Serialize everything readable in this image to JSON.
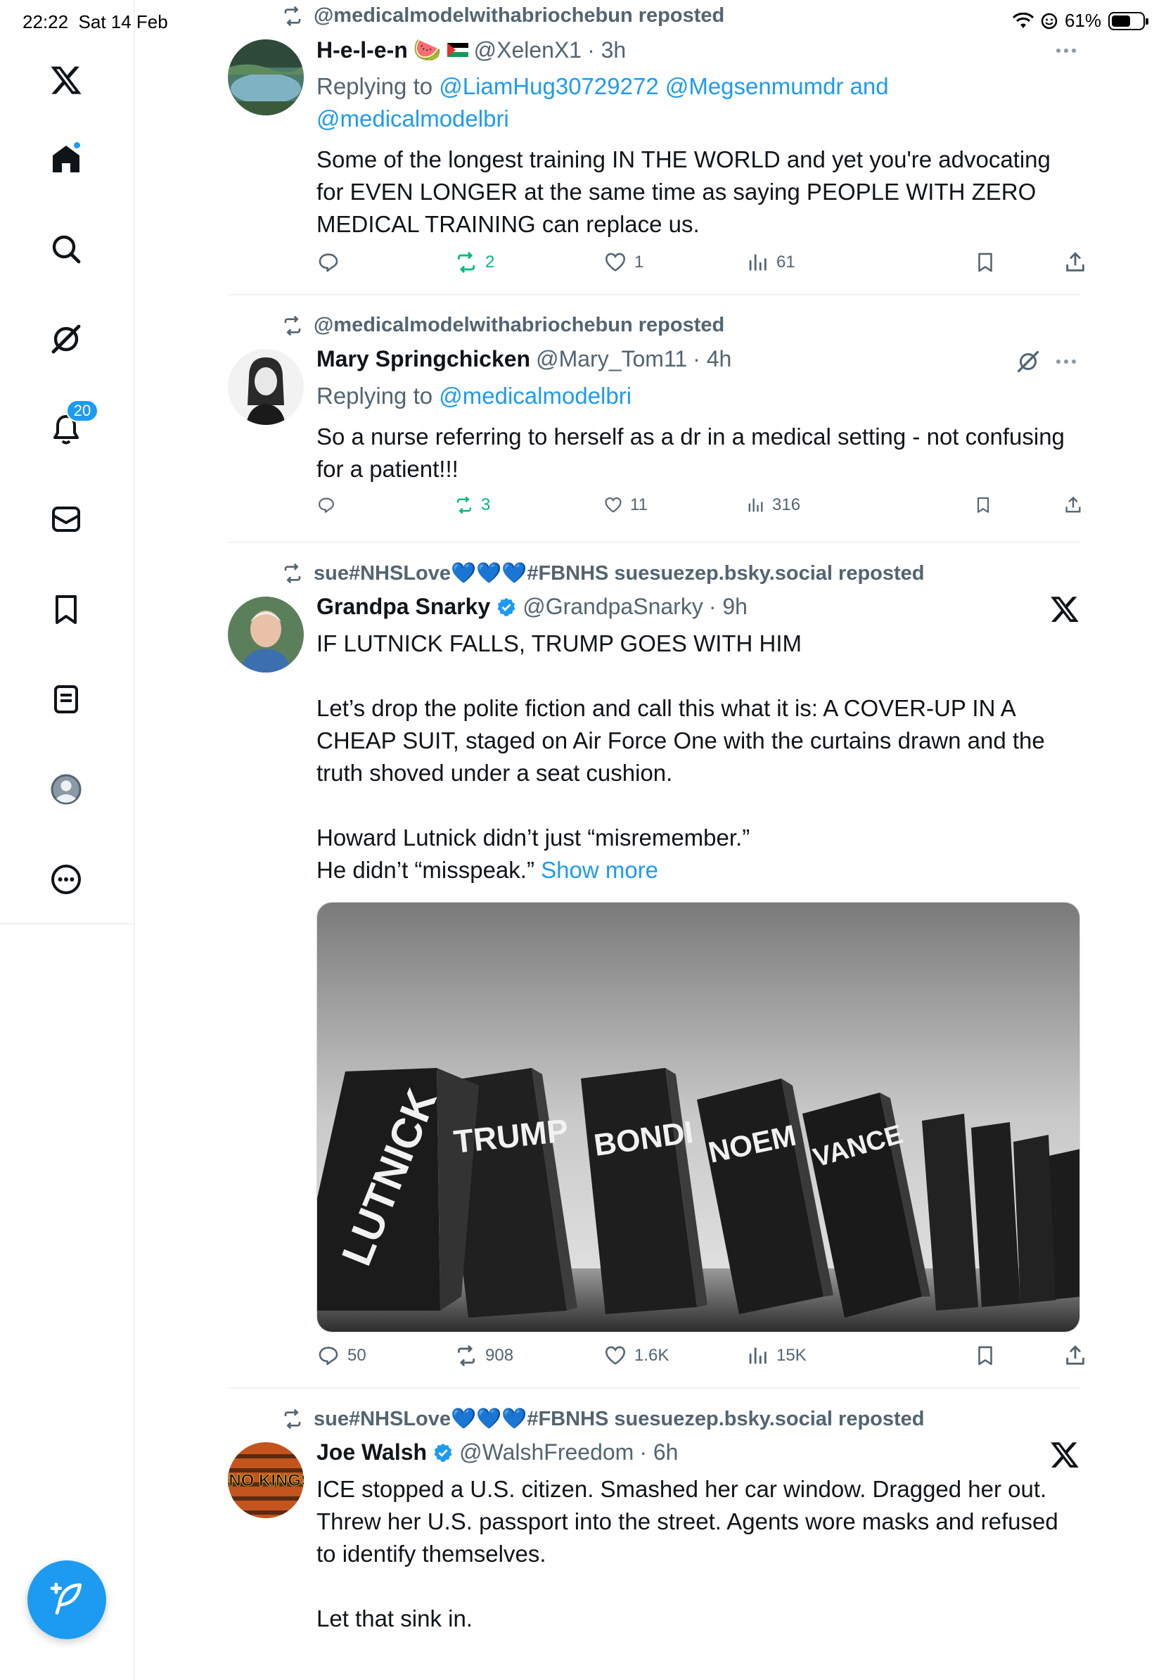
{
  "status": {
    "time": "22:22",
    "date": "Sat 14 Feb",
    "battery": "61%",
    "battery_level": 0.61
  },
  "sidebar": {
    "items": [
      {
        "icon": "x-logo-icon"
      },
      {
        "icon": "home-icon"
      },
      {
        "icon": "search-icon"
      },
      {
        "icon": "grok-icon"
      },
      {
        "icon": "bell-icon",
        "badge": "20"
      },
      {
        "icon": "mail-icon"
      },
      {
        "icon": "bookmark-icon"
      },
      {
        "icon": "list-icon"
      },
      {
        "icon": "profile-icon"
      },
      {
        "icon": "more-icon"
      }
    ],
    "compose_icon": "compose-icon"
  },
  "tweets": [
    {
      "repost_by": "@medicalmodelwithabriochebun reposted",
      "name": "H-e-l-e-n",
      "name_emoji": "🍉",
      "handle": "@XelenX1",
      "time": "· 3h",
      "reply_prefix": "Replying to",
      "reply_links": "@LiamHug30729272 @Megsenmumdr and",
      "reply_links_2": "@medicalmodelbri",
      "text": "Some of the longest training IN THE WORLD and yet you're advocating for EVEN LONGER at the same time as saying PEOPLE WITH ZERO MEDICAL TRAINING can replace us.",
      "stats": {
        "replies": "",
        "reposts": "2",
        "likes": "1",
        "views": "61"
      }
    },
    {
      "repost_by": "@medicalmodelwithabriochebun reposted",
      "name": "Mary Springchicken",
      "handle": "@Mary_Tom11",
      "time": "· 4h",
      "reply_prefix": "Replying to",
      "reply_links": "@medicalmodelbri",
      "text": "So a nurse referring to herself as a dr in a medical setting - not confusing for a patient!!!",
      "stats": {
        "replies": "",
        "reposts": "3",
        "likes": "11",
        "views": "316"
      }
    },
    {
      "repost_by": "sue#NHSLove💙💙💙#FBNHS suesuezep.bsky.social reposted",
      "name": "Grandpa Snarky",
      "handle": "@GrandpaSnarky",
      "time": "· 9h",
      "text": "IF LUTNICK FALLS, TRUMP GOES WITH HIM\n\nLet’s drop the polite fiction and call this what it is: A COVER-UP IN A CHEAP SUIT, staged on Air Force One with the curtains drawn and the truth shoved under a seat cushion.\n\nHoward Lutnick didn’t just “misremember.”\nHe didn’t “misspeak.” ",
      "show_more": "Show more",
      "image_words": [
        "LUTNICK",
        "TRUMP",
        "BONDI",
        "NOEM",
        "VANCE"
      ],
      "stats": {
        "replies": "50",
        "reposts": "908",
        "likes": "1.6K",
        "views": "15K"
      }
    },
    {
      "repost_by": "sue#NHSLove💙💙💙#FBNHS suesuezep.bsky.social reposted",
      "name": "Joe Walsh",
      "handle": "@WalshFreedom",
      "time": "· 6h",
      "avatar_text": "#NO KINGS",
      "text": "ICE stopped a U.S. citizen. Smashed her car window. Dragged her out. Threw her U.S. passport into the street. Agents wore masks and refused to identify themselves.\n\nLet that sink in."
    }
  ],
  "colors": {
    "accent": "#1d9bf0",
    "repost_green": "#00ba7c",
    "muted": "#536471"
  }
}
